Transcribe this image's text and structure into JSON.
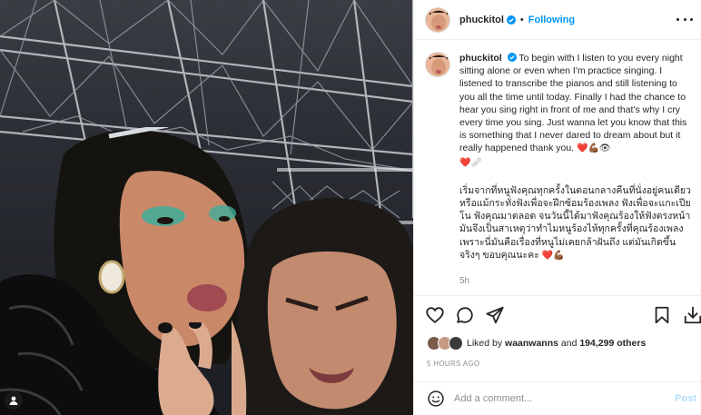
{
  "post": {
    "username": "phuckitol",
    "follow_label": "Following",
    "separator": "•",
    "caption_en": "To begin with I listen to you every night sitting alone or even when I'm practice singing. I listened to transcribe the pianos and still listening to you all the time until today. Finally I had the chance to hear you sing right in front of me and that's why I cry every time you sing. Just wanna let you know that this is something that I never dared to dream about but it really happened thank you.",
    "caption_en_emojis": "❤️💪🏾👁",
    "caption_en_emojis_line2": "❤️🩹",
    "caption_th": "เริ่มจากที่หนูฟังคุณทุกครั้งในตอนกลางคืนที่นั่งอยู่คนเดียว หรือแม้กระทั่งฟังเพื่อจะฝึกซ้อมร้องเพลง ฟังเพื่อจะแกะเปียโน ฟังคุณมาตลอด จนวันนี้ได้มาฟังคุณร้องให้ฟังตรงหน้า มันจึงเป็นสาเหตุว่าทำไมหนูร้องไห้ทุกครั้งที่คุณร้องเพลง เพราะนี่มันคือเรื่องที่หนูไม่เคยกล้าฝันถึง แต่มันเกิดขึ้นจริงๆ ขอบคุณนะคะ",
    "caption_th_emojis": "❤️💪🏾",
    "time_ago": "5h"
  },
  "likes": {
    "prefix": "Liked by",
    "user": "waanwanns",
    "connector": "and",
    "count": "194,299 others"
  },
  "timestamp": "5 HOURS AGO",
  "comment": {
    "placeholder": "Add a comment...",
    "post_label": "Post"
  },
  "colors": {
    "accent": "#0095f6",
    "heart": "#ed1c24",
    "muted": "#8e8e8e"
  },
  "icons": {
    "like": "heart-icon",
    "comment": "comment-icon",
    "share": "send-icon",
    "save": "bookmark-icon",
    "download": "download-icon",
    "emoji": "smiley-icon",
    "more": "more-icon",
    "verified": "verified-badge-icon",
    "photo_user": "user-tag-icon"
  }
}
